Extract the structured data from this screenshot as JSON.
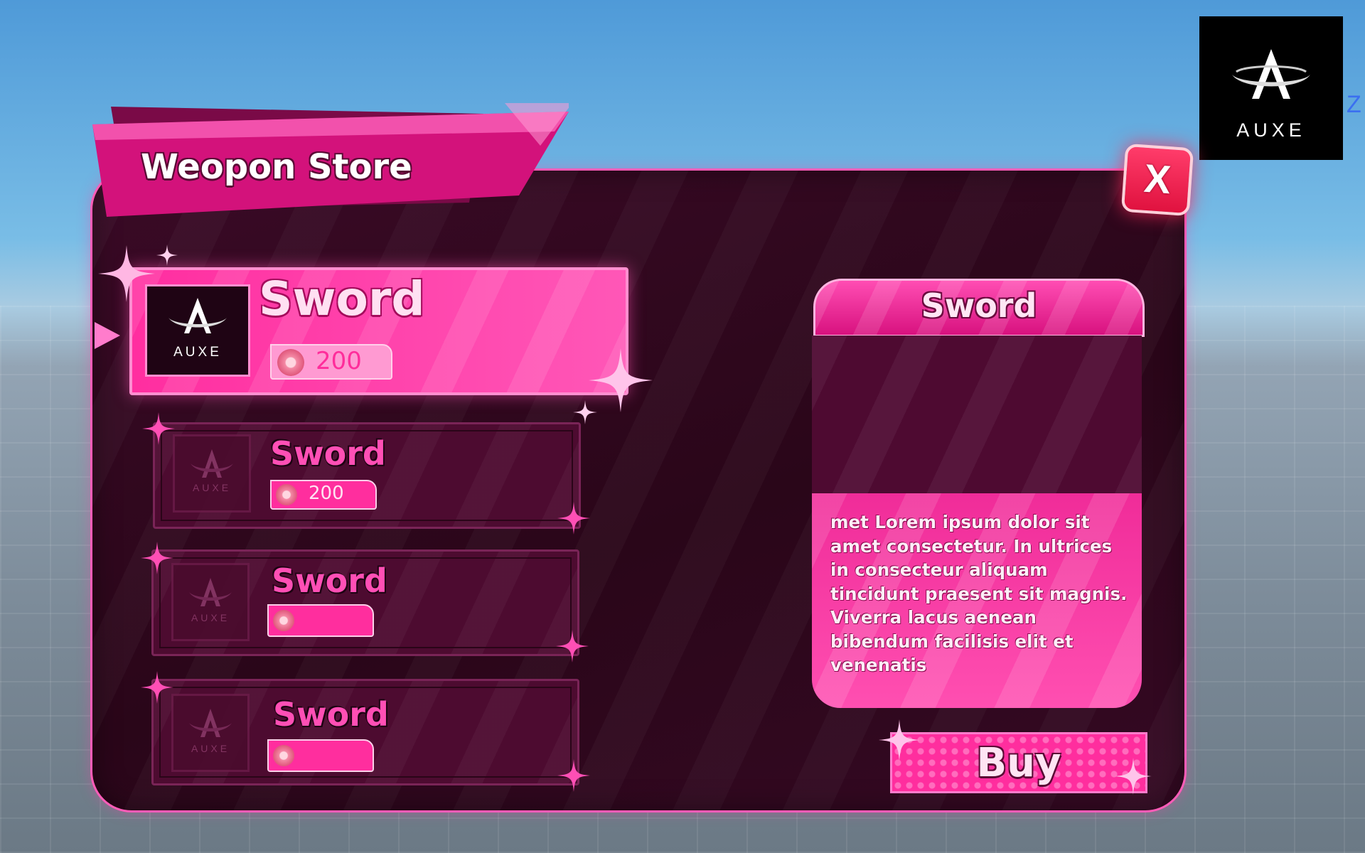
{
  "store": {
    "title": "Weopon Store",
    "close_label": "X"
  },
  "brand": {
    "name": "AUXE",
    "edge_letter": "Z"
  },
  "items": [
    {
      "name": "Sword",
      "price": "200",
      "selected": true
    },
    {
      "name": "Sword",
      "price": "200",
      "selected": false
    },
    {
      "name": "Sword",
      "price": "",
      "selected": false
    },
    {
      "name": "Sword",
      "price": "",
      "selected": false
    }
  ],
  "detail": {
    "title": "Sword",
    "description": "met  Lorem ipsum dolor sit amet consectetur. In ultrices in consecteur aliquam tincidunt praesent sit magnis. Viverra lacus aenean bibendum facilisis elit et venenatis",
    "buy_label": "Buy"
  },
  "colors": {
    "accent": "#ff2e9e",
    "panel": "#2a0619",
    "close": "#e0123f"
  },
  "icons": [
    "auxe-logo-icon",
    "coin-icon",
    "sparkle-icon",
    "close-icon",
    "pointer-icon"
  ]
}
